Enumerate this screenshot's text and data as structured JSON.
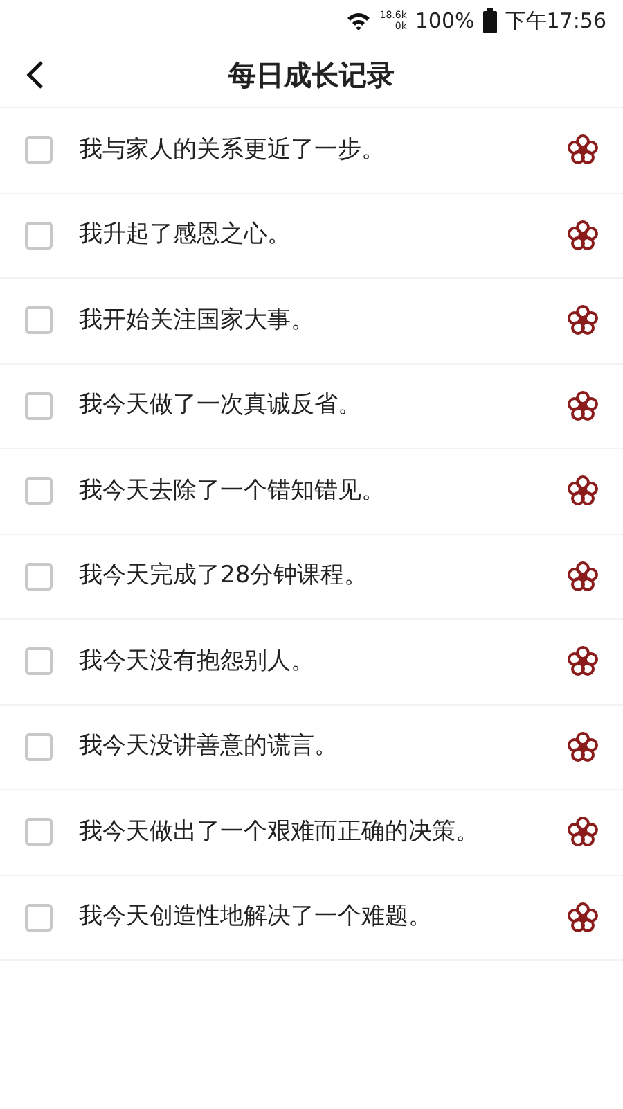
{
  "status_bar": {
    "net_up": "18.6k",
    "net_down": "0k",
    "battery": "100%",
    "time": "下午17:56"
  },
  "header": {
    "title": "每日成长记录"
  },
  "items": [
    {
      "text": "我与家人的关系更近了一步。",
      "checked": false
    },
    {
      "text": "我升起了感恩之心。",
      "checked": false
    },
    {
      "text": "我开始关注国家大事。",
      "checked": false
    },
    {
      "text": "我今天做了一次真诚反省。",
      "checked": false
    },
    {
      "text": "我今天去除了一个错知错见。",
      "checked": false
    },
    {
      "text": "我今天完成了28分钟课程。",
      "checked": false
    },
    {
      "text": "我今天没有抱怨别人。",
      "checked": false
    },
    {
      "text": "我今天没讲善意的谎言。",
      "checked": false
    },
    {
      "text": "我今天做出了一个艰难而正确的决策。",
      "checked": false
    },
    {
      "text": "我今天创造性地解决了一个难题。",
      "checked": false
    }
  ]
}
